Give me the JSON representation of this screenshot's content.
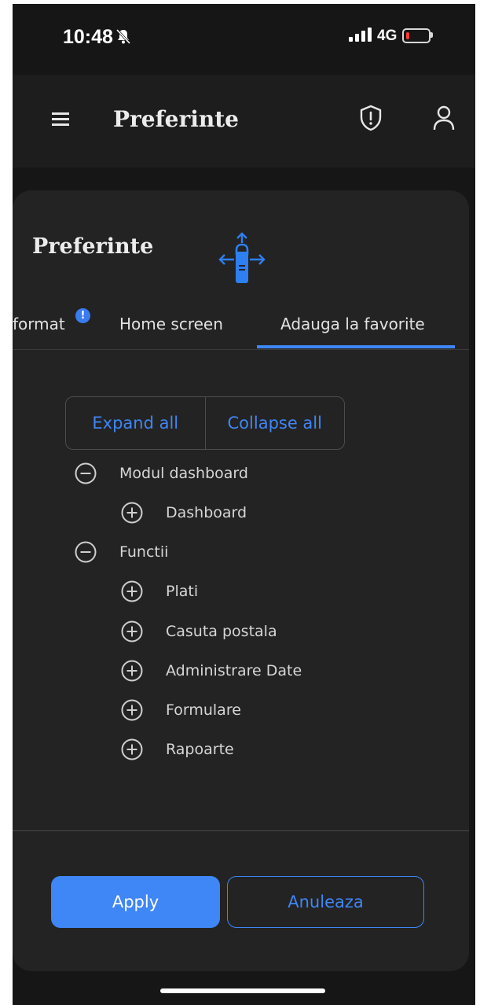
{
  "status_bar": {
    "time": "10:48",
    "network": "4G",
    "icons": [
      "bell-off-icon",
      "signal-icon",
      "battery-icon"
    ],
    "battery_color": "#ff3b30"
  },
  "app_bar": {
    "title": "Preferinte",
    "icons": [
      "menu-icon",
      "shield-alert-icon",
      "user-icon"
    ]
  },
  "sheet": {
    "title": "Preferinte",
    "tabs": [
      {
        "label": "format",
        "has_badge": true,
        "badge": "!"
      },
      {
        "label": "Home screen"
      },
      {
        "label": "Adauga la favorite",
        "selected": true
      }
    ],
    "expand_all": "Expand all",
    "collapse_all": "Collapse all",
    "tree": [
      {
        "label": "Modul dashboard",
        "level": 0,
        "state": "expanded"
      },
      {
        "label": "Dashboard",
        "level": 1,
        "state": "collapsed"
      },
      {
        "label": "Functii",
        "level": 0,
        "state": "expanded"
      },
      {
        "label": "Plati",
        "level": 1,
        "state": "collapsed"
      },
      {
        "label": "Casuta postala",
        "level": 1,
        "state": "collapsed"
      },
      {
        "label": "Administrare Date",
        "level": 1,
        "state": "collapsed"
      },
      {
        "label": "Formulare",
        "level": 1,
        "state": "collapsed"
      },
      {
        "label": "Rapoarte",
        "level": 1,
        "state": "collapsed"
      }
    ],
    "apply_label": "Apply",
    "cancel_label": "Anuleaza"
  },
  "colors": {
    "accent": "#3f86f7",
    "background": "#161616",
    "sheet": "#232323"
  }
}
